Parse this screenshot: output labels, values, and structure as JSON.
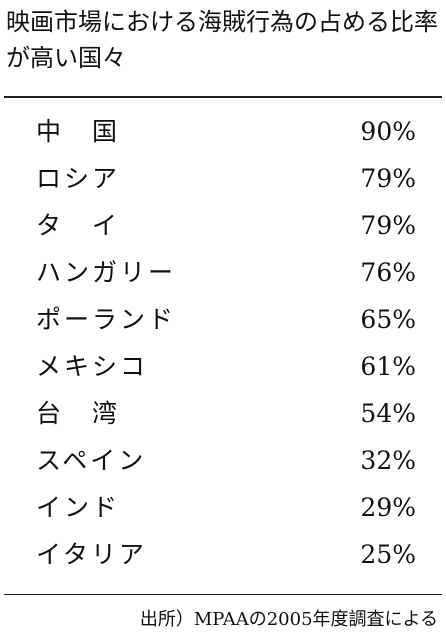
{
  "title": "映画市場における海賊行為の占める比率が高い国々",
  "rows": [
    {
      "country": "中　国",
      "share": "90%"
    },
    {
      "country": "ロシア",
      "share": "79%"
    },
    {
      "country": "タ　イ",
      "share": "79%"
    },
    {
      "country": "ハンガリー",
      "share": "76%"
    },
    {
      "country": "ポーランド",
      "share": "65%"
    },
    {
      "country": "メキシコ",
      "share": "61%"
    },
    {
      "country": "台　湾",
      "share": "54%"
    },
    {
      "country": "スペイン",
      "share": "32%"
    },
    {
      "country": "インド",
      "share": "29%"
    },
    {
      "country": "イタリア",
      "share": "25%"
    }
  ],
  "source": "出所）MPAAの2005年度調査による"
}
